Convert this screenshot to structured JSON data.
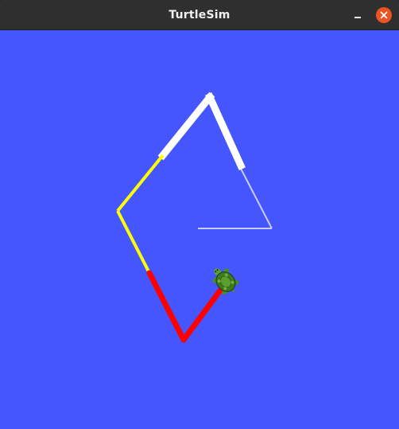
{
  "window": {
    "title": "TurtleSim",
    "background_color": "#4556ff",
    "minimize_icon": "minimize-icon",
    "close_icon": "close-icon"
  },
  "simulation": {
    "trail_colors": [
      "#ffffff",
      "#ffff00",
      "#ff0000",
      "#c8cdff"
    ],
    "turtle_icon": "turtle-icon"
  }
}
